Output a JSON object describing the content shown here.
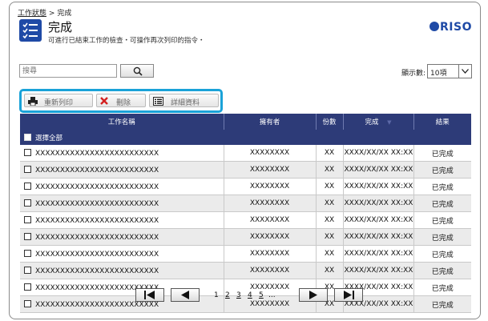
{
  "breadcrumb": {
    "parent": "工作狀態",
    "separator": ">",
    "current": "完成"
  },
  "header": {
    "title": "完成",
    "subtitle": "可進行已結束工作的檢查・可操作再次列印的指令・",
    "title_icon": "list-icon",
    "logo": "RISO",
    "logo_icon": "riso-logo"
  },
  "search": {
    "placeholder": "搜尋",
    "button_icon": "search-icon"
  },
  "page_size": {
    "label": "顯示數:",
    "value": "10項"
  },
  "toolbar": {
    "reprint_label": "重新列印",
    "reprint_icon": "print-icon",
    "delete_label": "刪除",
    "delete_icon": "delete-x-icon",
    "details_label": "詳細資料",
    "details_icon": "details-icon",
    "highlight_color": "#1aa2d8"
  },
  "table": {
    "headers": [
      "工作名稱",
      "擁有者",
      "份數",
      "完成",
      "結果"
    ],
    "select_all_label": "選擇全部",
    "sort_icon": "sort-down-icon",
    "header_color": "#2d3b78",
    "rows": [
      {
        "name": "XXXXXXXXXXXXXXXXXXXXXXXXX",
        "owner": "XXXXXXXX",
        "copies": "XX",
        "completed": "XXXX/XX/XX XX:XX",
        "result": "已完成"
      },
      {
        "name": "XXXXXXXXXXXXXXXXXXXXXXXXX",
        "owner": "XXXXXXXX",
        "copies": "XX",
        "completed": "XXXX/XX/XX XX:XX",
        "result": "已完成"
      },
      {
        "name": "XXXXXXXXXXXXXXXXXXXXXXXXX",
        "owner": "XXXXXXXX",
        "copies": "XX",
        "completed": "XXXX/XX/XX XX:XX",
        "result": "已完成"
      },
      {
        "name": "XXXXXXXXXXXXXXXXXXXXXXXXX",
        "owner": "XXXXXXXX",
        "copies": "XX",
        "completed": "XXXX/XX/XX XX:XX",
        "result": "已完成"
      },
      {
        "name": "XXXXXXXXXXXXXXXXXXXXXXXXX",
        "owner": "XXXXXXXX",
        "copies": "XX",
        "completed": "XXXX/XX/XX XX:XX",
        "result": "已完成"
      },
      {
        "name": "XXXXXXXXXXXXXXXXXXXXXXXXX",
        "owner": "XXXXXXXX",
        "copies": "XX",
        "completed": "XXXX/XX/XX XX:XX",
        "result": "已完成"
      },
      {
        "name": "XXXXXXXXXXXXXXXXXXXXXXXXX",
        "owner": "XXXXXXXX",
        "copies": "XX",
        "completed": "XXXX/XX/XX XX:XX",
        "result": "已完成"
      },
      {
        "name": "XXXXXXXXXXXXXXXXXXXXXXXXX",
        "owner": "XXXXXXXX",
        "copies": "XX",
        "completed": "XXXX/XX/XX XX:XX",
        "result": "已完成"
      },
      {
        "name": "XXXXXXXXXXXXXXXXXXXXXXXXX",
        "owner": "XXXXXXXX",
        "copies": "XX",
        "completed": "XXXX/XX/XX XX:XX",
        "result": "已完成"
      },
      {
        "name": "XXXXXXXXXXXXXXXXXXXXXXXXX",
        "owner": "XXXXXXXX",
        "copies": "XX",
        "completed": "XXXX/XX/XX XX:XX",
        "result": "已完成"
      }
    ]
  },
  "pagination": {
    "first_icon": "first-page-icon",
    "prev_icon": "prev-page-icon",
    "next_icon": "next-page-icon",
    "last_icon": "last-page-icon",
    "current_page": "1",
    "pages": [
      "2",
      "3",
      "4",
      "5"
    ],
    "ellipsis": "..."
  }
}
